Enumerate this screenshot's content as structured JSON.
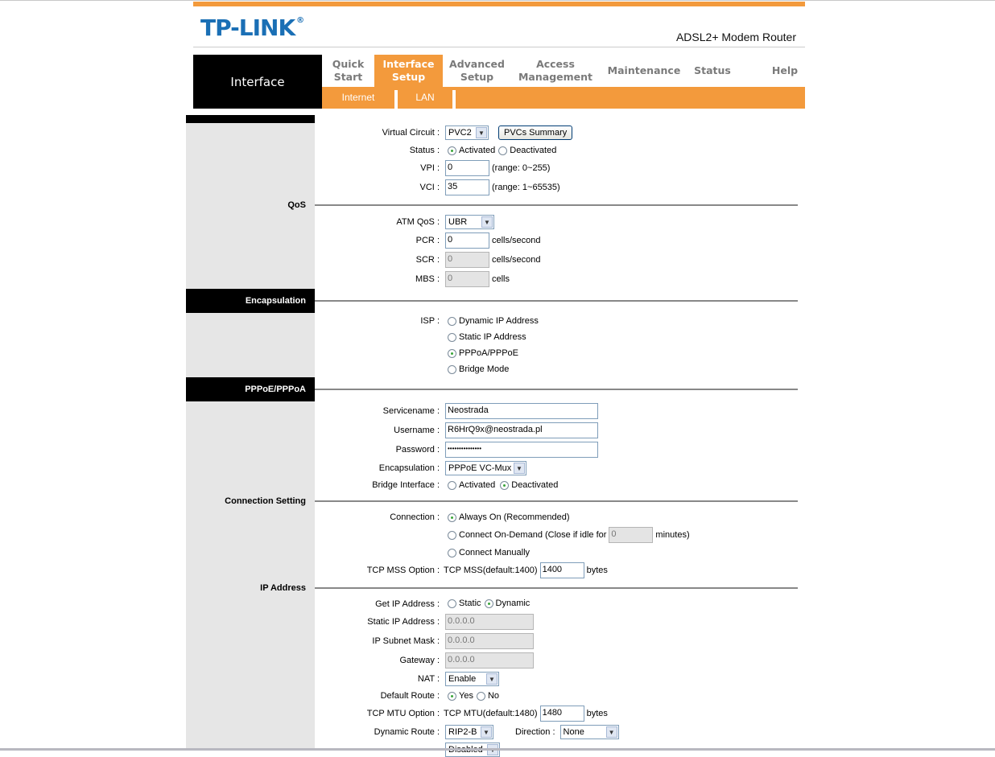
{
  "brand": {
    "logo": "TP-LINK",
    "registered": "®",
    "product": "ADSL2+ Modem Router"
  },
  "colors": {
    "accent": "#f39a3c",
    "logo_blue": "#1a6fb5",
    "sidebar": "#e6e6e6"
  },
  "page_tab": "Interface",
  "nav": [
    {
      "label": "Quick Start",
      "l1": "Quick",
      "l2": "Start",
      "active": false
    },
    {
      "label": "Interface Setup",
      "l1": "Interface",
      "l2": "Setup",
      "active": true
    },
    {
      "label": "Advanced Setup",
      "l1": "Advanced",
      "l2": "Setup",
      "active": false
    },
    {
      "label": "Access Management",
      "l1": "Access",
      "l2": "Management",
      "active": false
    },
    {
      "label": "Maintenance",
      "l1": "Maintenance",
      "l2": "",
      "active": false
    },
    {
      "label": "Status",
      "l1": "Status",
      "l2": "",
      "active": false
    },
    {
      "label": "Help",
      "l1": "Help",
      "l2": "",
      "active": false
    }
  ],
  "subnav": [
    {
      "label": "Internet",
      "active": true
    },
    {
      "label": "LAN",
      "active": false
    }
  ],
  "sections": {
    "qos": "QoS",
    "encapsulation": "Encapsulation",
    "pppoe": "PPPoE/PPPoA",
    "connection": "Connection Setting",
    "ip": "IP Address"
  },
  "sep": ":",
  "atm": {
    "virtual_circuit": {
      "label": "Virtual Circuit",
      "value": "PVC2",
      "button": "PVCs Summary"
    },
    "status": {
      "label": "Status",
      "options": [
        "Activated",
        "Deactivated"
      ],
      "selected": "Activated"
    },
    "vpi": {
      "label": "VPI",
      "value": "0",
      "hint": "(range: 0~255)"
    },
    "vci": {
      "label": "VCI",
      "value": "35",
      "hint": "(range: 1~65535)"
    }
  },
  "qos": {
    "atm_qos": {
      "label": "ATM QoS",
      "value": "UBR"
    },
    "pcr": {
      "label": "PCR",
      "value": "0",
      "unit": "cells/second"
    },
    "scr": {
      "label": "SCR",
      "value": "0",
      "unit": "cells/second"
    },
    "mbs": {
      "label": "MBS",
      "value": "0",
      "unit": "cells"
    }
  },
  "isp": {
    "label": "ISP",
    "options": [
      "Dynamic IP Address",
      "Static IP Address",
      "PPPoA/PPPoE",
      "Bridge Mode"
    ],
    "selected": "PPPoA/PPPoE"
  },
  "pppoe": {
    "servicename": {
      "label": "Servicename",
      "value": "Neostrada"
    },
    "username": {
      "label": "Username",
      "value": "R6HrQ9x@neostrada.pl"
    },
    "password": {
      "label": "Password",
      "value": "•••••••••••••••"
    },
    "encapsulation": {
      "label": "Encapsulation",
      "value": "PPPoE VC-Mux"
    },
    "bridge": {
      "label": "Bridge Interface",
      "options": [
        "Activated",
        "Deactivated"
      ],
      "selected": "Deactivated"
    }
  },
  "connection": {
    "label": "Connection",
    "always_on": "Always On (Recommended)",
    "on_demand_pre": "Connect On-Demand (Close if idle for",
    "on_demand_value": "0",
    "on_demand_post": "minutes)",
    "manual": "Connect Manually",
    "selected": "Always On (Recommended)",
    "mss": {
      "label": "TCP MSS Option",
      "text": "TCP MSS(default:1400)",
      "value": "1400",
      "unit": "bytes"
    }
  },
  "ip": {
    "get_ip": {
      "label": "Get IP Address",
      "options": [
        "Static",
        "Dynamic"
      ],
      "selected": "Dynamic"
    },
    "static_ip": {
      "label": "Static IP Address",
      "value": "0.0.0.0"
    },
    "subnet": {
      "label": "IP Subnet Mask",
      "value": "0.0.0.0"
    },
    "gateway": {
      "label": "Gateway",
      "value": "0.0.0.0"
    },
    "nat": {
      "label": "NAT",
      "value": "Enable"
    },
    "default_route": {
      "label": "Default Route",
      "options": [
        "Yes",
        "No"
      ],
      "selected": "Yes"
    },
    "mtu": {
      "label": "TCP MTU Option",
      "text": "TCP MTU(default:1480)",
      "value": "1480",
      "unit": "bytes"
    },
    "dynamic_route": {
      "label": "Dynamic Route",
      "value": "RIP2-B",
      "direction_label": "Direction",
      "direction": "None"
    },
    "multicast": {
      "value": "Disabled"
    }
  }
}
